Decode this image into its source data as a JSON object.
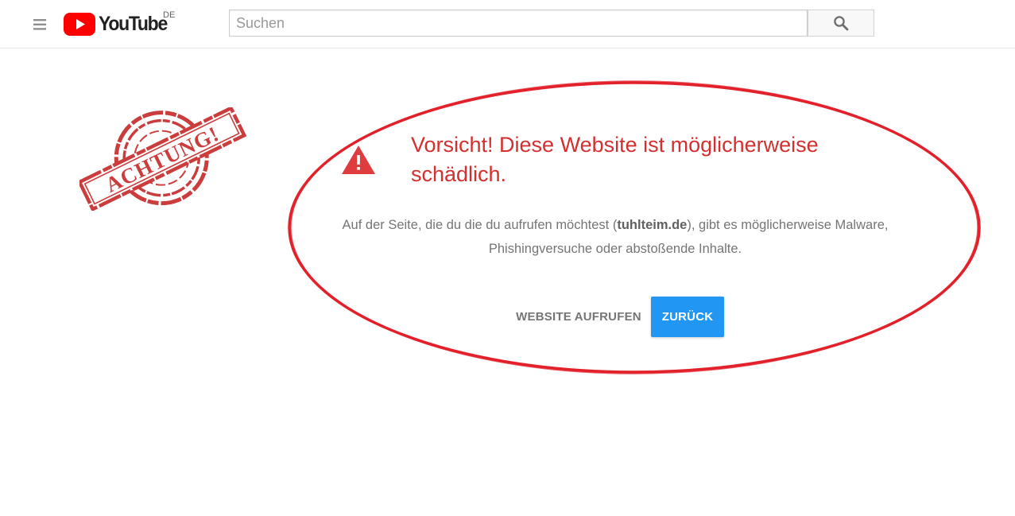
{
  "header": {
    "brand": "YouTube",
    "region": "DE",
    "search": {
      "placeholder": "Suchen",
      "value": ""
    }
  },
  "stamp": {
    "text": "ACHTUNG!",
    "color": "#c62828"
  },
  "warning": {
    "title": "Vorsicht! Diese Website ist möglicherweise schädlich.",
    "message_before": "Auf der Seite, die du die du aufrufen möchtest (",
    "domain": "tuhlteim.de",
    "message_after": "), gibt es möglicherweise Malware, Phishingversuche oder abstoßende Inhalte.",
    "visit_label": "WEBSITE AUFRUFEN",
    "back_label": "ZURÜCK"
  },
  "colors": {
    "warning_red": "#d32f2f",
    "ellipse_red": "#e3212b",
    "button_blue": "#2196f3",
    "youtube_red": "#ff0000"
  },
  "icons": {
    "menu": "hamburger-menu-icon",
    "logo": "youtube-play-icon",
    "search": "magnifier-icon",
    "warning": "warning-triangle-icon"
  }
}
